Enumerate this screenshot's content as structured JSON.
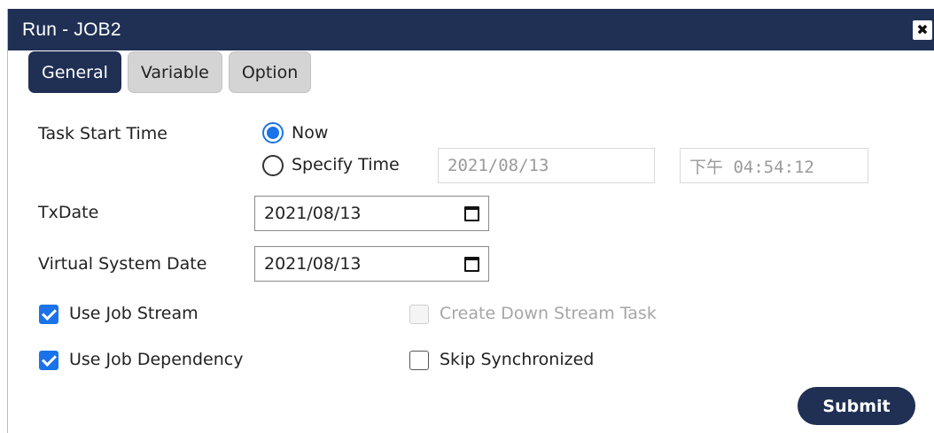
{
  "window": {
    "title": "Run - JOB2",
    "close_glyph": "✖"
  },
  "tabs": [
    {
      "label": "General",
      "active": true
    },
    {
      "label": "Variable",
      "active": false
    },
    {
      "label": "Option",
      "active": false
    }
  ],
  "task_start_time": {
    "label": "Task Start Time",
    "options": [
      {
        "label": "Now",
        "selected": true
      },
      {
        "label": "Specify Time",
        "selected": false
      }
    ],
    "date_value": "2021/08/13",
    "time_value": "下午 04:54:12"
  },
  "txdate": {
    "label": "TxDate",
    "value": "2021/08/13"
  },
  "virtual_system_date": {
    "label": "Virtual System Date",
    "value": "2021/08/13"
  },
  "checkboxes": {
    "use_job_stream": {
      "label": "Use Job Stream",
      "checked": true
    },
    "use_job_dependency": {
      "label": "Use Job Dependency",
      "checked": true
    },
    "create_down_stream_task": {
      "label": "Create Down Stream Task",
      "checked": false,
      "disabled": true
    },
    "skip_synchronized": {
      "label": "Skip Synchronized",
      "checked": false
    }
  },
  "submit_label": "Submit",
  "colors": {
    "header": "#1f3054",
    "accent": "#1a73e8",
    "tab_inactive": "#d4d4d4"
  }
}
